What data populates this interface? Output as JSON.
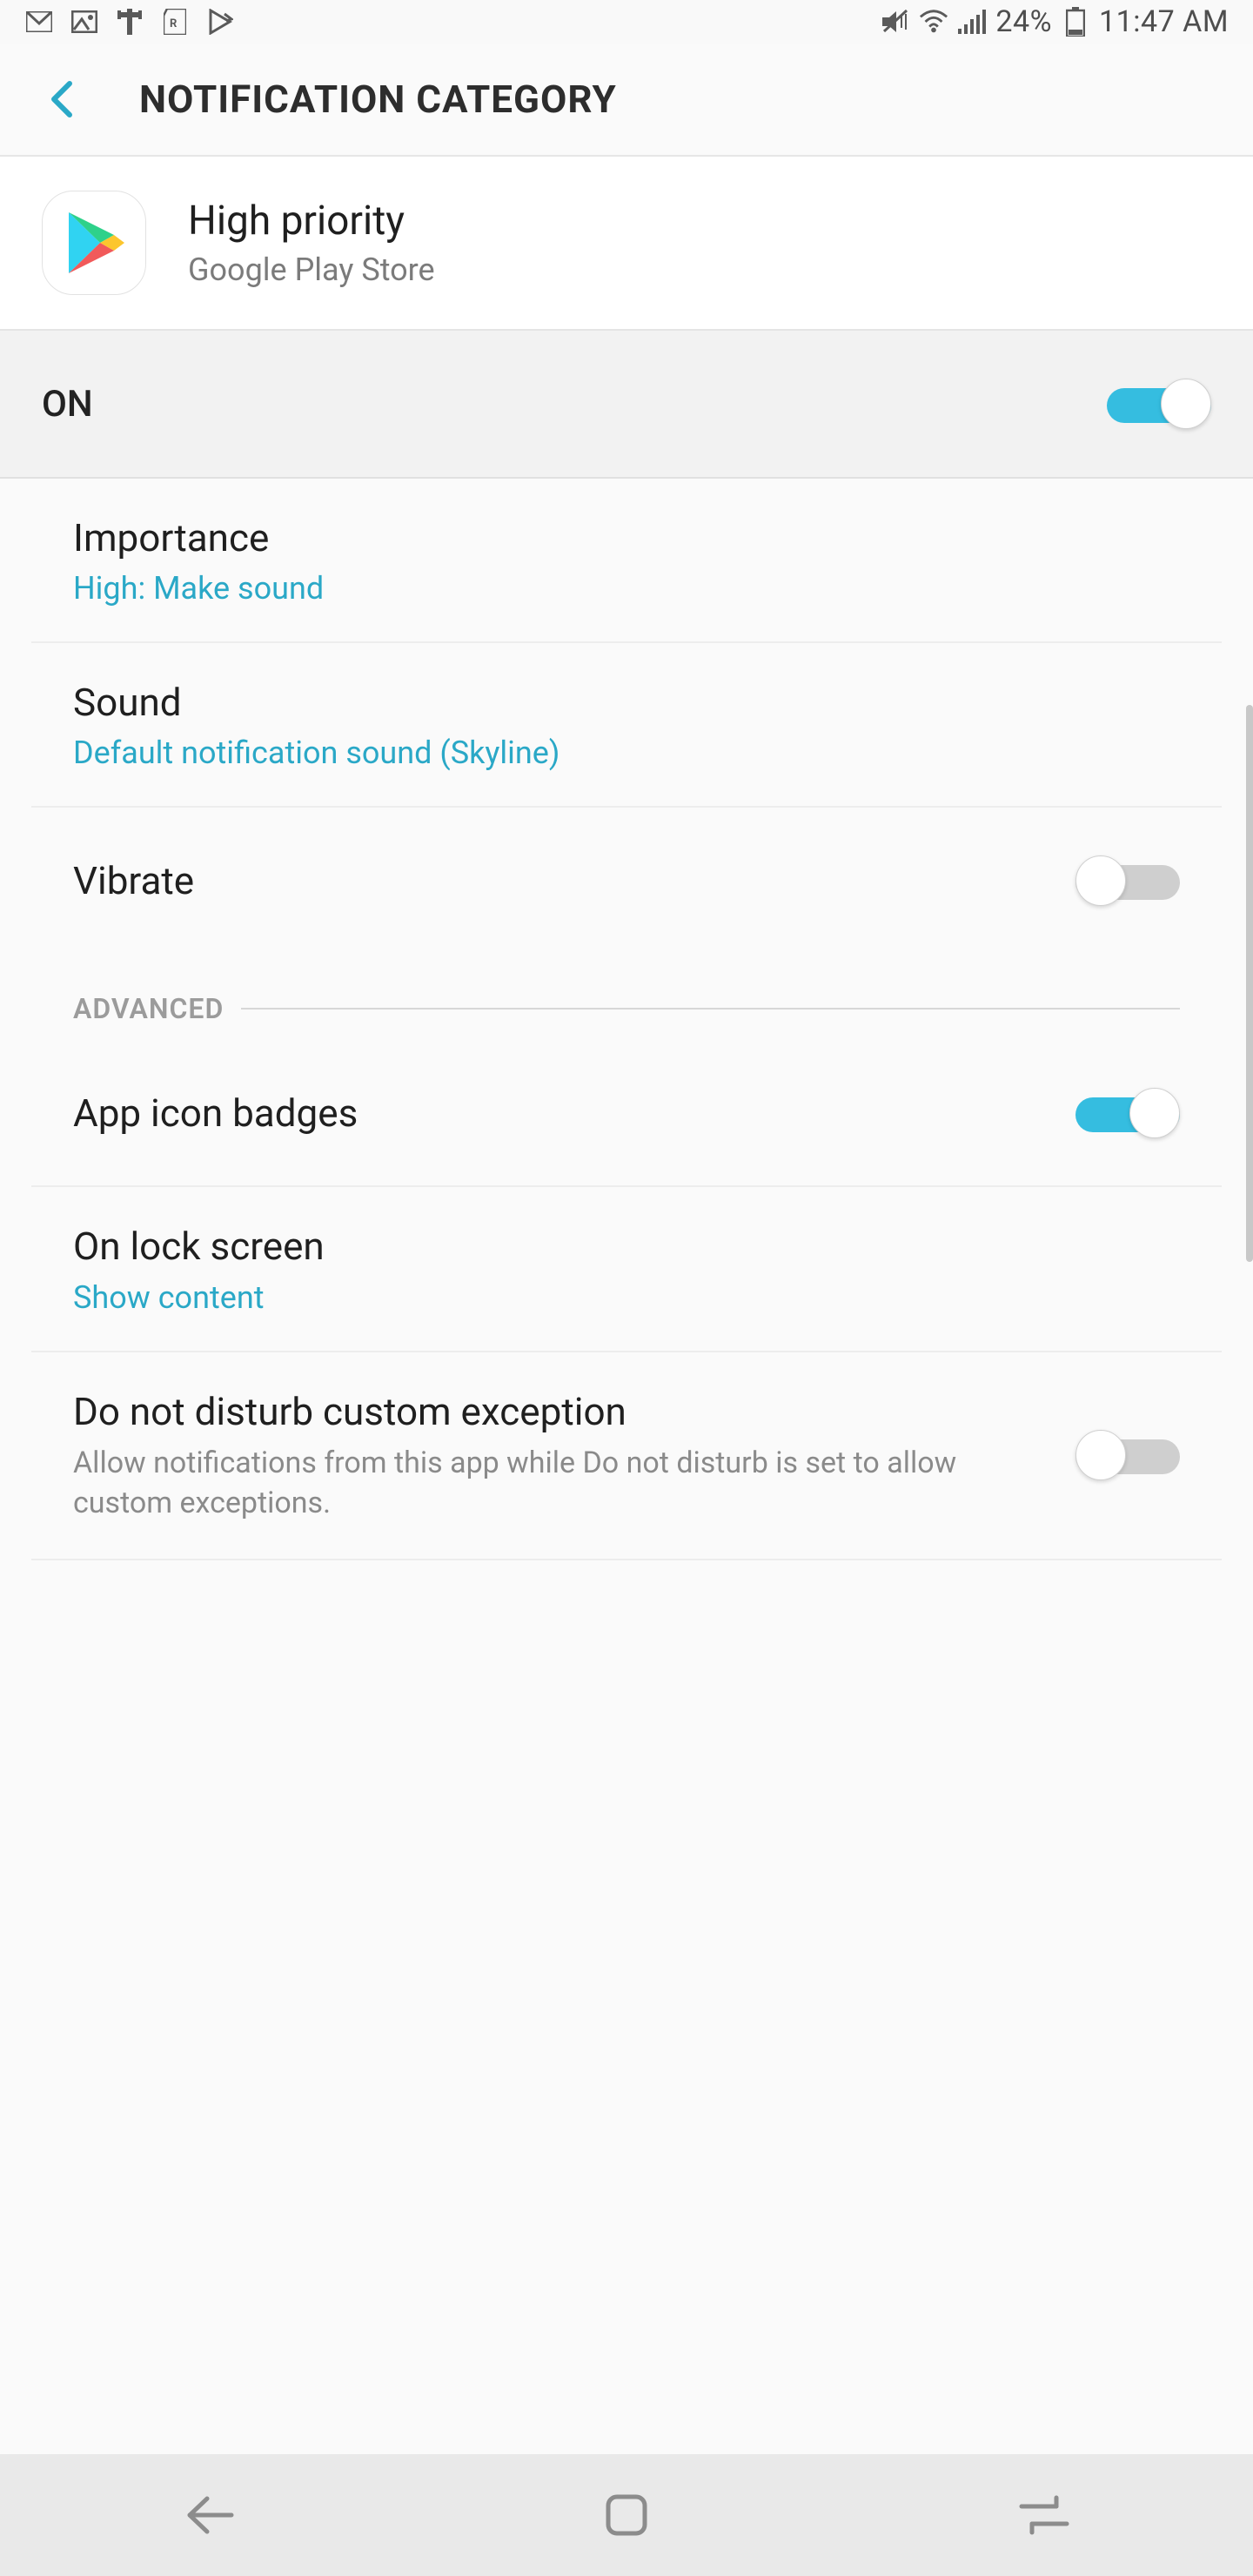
{
  "statusbar": {
    "battery": "24%",
    "time": "11:47 AM"
  },
  "header": {
    "title": "NOTIFICATION CATEGORY"
  },
  "app": {
    "category": "High priority",
    "name": "Google Play Store"
  },
  "master": {
    "label": "ON",
    "enabled": true
  },
  "rows": {
    "importance": {
      "title": "Importance",
      "value": "High: Make sound"
    },
    "sound": {
      "title": "Sound",
      "value": "Default notification sound (Skyline)"
    },
    "vibrate": {
      "title": "Vibrate",
      "enabled": false
    },
    "badges": {
      "title": "App icon badges",
      "enabled": true
    },
    "lockscreen": {
      "title": "On lock screen",
      "value": "Show content"
    },
    "dnd": {
      "title": "Do not disturb custom exception",
      "desc": "Allow notifications from this app while Do not disturb is set to allow custom exceptions.",
      "enabled": false
    }
  },
  "sections": {
    "advanced": "ADVANCED"
  }
}
